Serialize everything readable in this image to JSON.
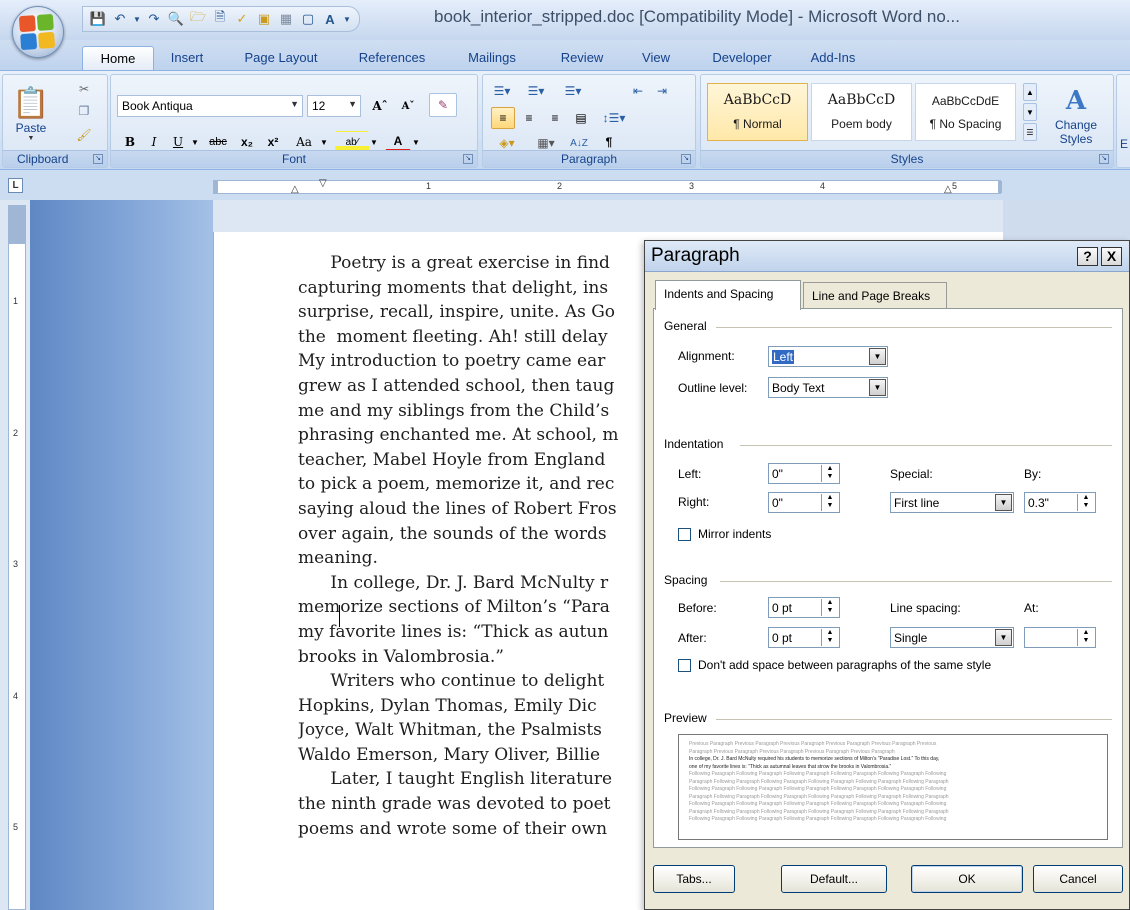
{
  "titlebar": {
    "title": "book_interior_stripped.doc [Compatibility Mode] - Microsoft Word no...",
    "qat_icons": [
      "save-icon",
      "undo-icon",
      "redo-icon",
      "print-preview-icon",
      "open-icon",
      "new-icon",
      "spelling-icon",
      "insert-icon",
      "insert-textbox-icon",
      "text-effects-icon",
      "customize-qat-icon"
    ]
  },
  "ribbon": {
    "tabs": [
      "Home",
      "Insert",
      "Page Layout",
      "References",
      "Mailings",
      "Review",
      "View",
      "Developer",
      "Add-Ins"
    ],
    "active_tab": "Home",
    "clipboard": {
      "label": "Clipboard",
      "paste": "Paste"
    },
    "font": {
      "label": "Font",
      "name": "Book Antiqua",
      "size": "12"
    },
    "paragraph": {
      "label": "Paragraph"
    },
    "styles": {
      "label": "Styles",
      "items": [
        {
          "sample": "AaBbCcD",
          "name": "¶ Normal",
          "selected": true
        },
        {
          "sample": "AaBbCcD",
          "name": "Poem body",
          "selected": false
        },
        {
          "sample": "AaBbCcDdE",
          "name": "¶ No Spacing",
          "selected": false
        }
      ],
      "change_styles": "Change Styles",
      "change_styles_line1": "Change",
      "change_styles_line2": "Styles",
      "editing_partial": "E"
    }
  },
  "ruler": {
    "corner": "L",
    "h_numbers": [
      "1",
      "2",
      "3",
      "4",
      "5"
    ],
    "v_numbers": [
      "1",
      "2",
      "3",
      "4",
      "5"
    ]
  },
  "document": {
    "lines": [
      "      Poetry is a great exercise in find",
      "capturing moments that delight, ins",
      "surprise, recall, inspire, unite. As Go",
      "the  moment fleeting. Ah! still delay",
      "My introduction to poetry came ear",
      "grew as I attended school, then taug",
      "me and my siblings from the Child’s",
      "phrasing enchanted me. At school, m",
      "teacher, Mabel Hoyle from England",
      "to pick a poem, memorize it, and rec",
      "saying aloud the lines of Robert Fros",
      "over again, the sounds of the words",
      "meaning.",
      "      In college, Dr. J. Bard McNulty r",
      "memorize sections of Milton’s “Para",
      "my favorite lines is: “Thick as autun",
      "brooks in Valombrosia.”",
      "      Writers who continue to delight",
      "Hopkins, Dylan Thomas, Emily Dic",
      "Joyce, Walt Whitman, the Psalmists",
      "Waldo Emerson, Mary Oliver, Billie",
      "      Later, I taught English literature",
      "the ninth grade was devoted to poet",
      "poems and wrote some of their own"
    ]
  },
  "dialog": {
    "title": "Paragraph",
    "help": "?",
    "close": "X",
    "tabs": [
      "Indents and Spacing",
      "Line and Page Breaks"
    ],
    "general": {
      "header": "General",
      "alignment_label": "Alignment:",
      "alignment": "Left",
      "outline_label": "Outline level:",
      "outline": "Body Text"
    },
    "indentation": {
      "header": "Indentation",
      "left_label": "Left:",
      "left": "0\"",
      "right_label": "Right:",
      "right": "0\"",
      "special_label": "Special:",
      "special": "First line",
      "by_label": "By:",
      "by": "0.3\"",
      "mirror_label": "Mirror indents"
    },
    "spacing": {
      "header": "Spacing",
      "before_label": "Before:",
      "before": "0 pt",
      "after_label": "After:",
      "after": "0 pt",
      "line_spacing_label": "Line spacing:",
      "line_spacing": "Single",
      "at_label": "At:",
      "at": "",
      "dont_add_label": "Don't add space between paragraphs of the same style"
    },
    "preview": {
      "header": "Preview",
      "lines": [
        "Previous Paragraph Previous Paragraph Previous Paragraph Previous Paragraph Previous Paragraph Previous",
        "Paragraph Previous Paragraph Previous Paragraph Previous Paragraph Previous Paragraph",
        "In college, Dr. J. Bard McNulty required his students to memorize sections of Milton’s “Paradise Lost.” To this day,",
        "one of my favorite lines is: “Thick as autumnal leaves that strow the brooks in Valombrosia.”",
        "Following Paragraph Following Paragraph Following Paragraph Following Paragraph Following Paragraph Following",
        "Paragraph Following Paragraph Following Paragraph Following Paragraph Following Paragraph Following Paragraph",
        "Following Paragraph Following Paragraph Following Paragraph Following Paragraph Following Paragraph Following",
        "Paragraph Following Paragraph Following Paragraph Following Paragraph Following Paragraph Following Paragraph",
        "Following Paragraph Following Paragraph Following Paragraph Following Paragraph Following Paragraph Following",
        "Paragraph Following Paragraph Following Paragraph Following Paragraph Following Paragraph Following Paragraph",
        "Following Paragraph Following Paragraph Following Paragraph Following Paragraph Following Paragraph Following"
      ]
    },
    "buttons": {
      "tabs": "Tabs...",
      "default": "Default...",
      "ok": "OK",
      "cancel": "Cancel"
    }
  }
}
